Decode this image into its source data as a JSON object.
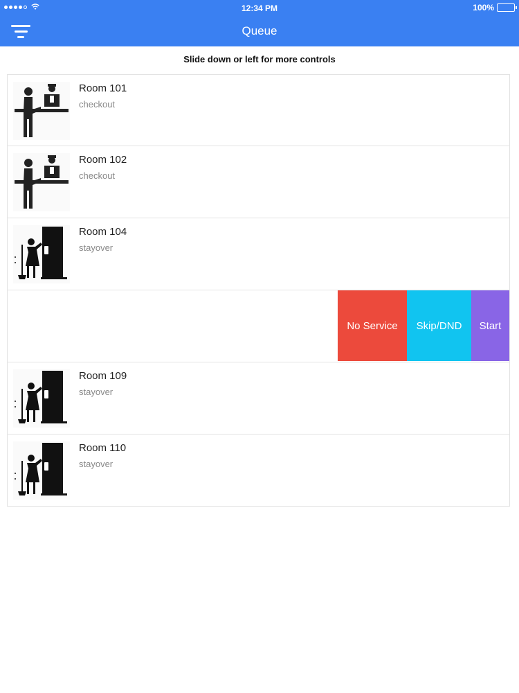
{
  "status_bar": {
    "time": "12:34 PM",
    "battery": "100%",
    "signal_bars": 4,
    "battery_level": 1.0
  },
  "nav": {
    "title": "Queue",
    "filter_icon": "filter-icon"
  },
  "hint": "Slide down or left for more controls",
  "queue": [
    {
      "room": "Room 101",
      "type": "checkout",
      "icon": "checkout-icon"
    },
    {
      "room": "Room 102",
      "type": "checkout",
      "icon": "checkout-icon"
    },
    {
      "room": "Room 104",
      "type": "stayover",
      "icon": "stayover-icon"
    },
    {
      "room": "",
      "type": "",
      "icon": ""
    },
    {
      "room": "Room 109",
      "type": "stayover",
      "icon": "stayover-icon"
    },
    {
      "room": "Room 110",
      "type": "stayover",
      "icon": "stayover-icon"
    }
  ],
  "swipe_actions": {
    "no_service": "No Service",
    "skip_dnd": "Skip/DND",
    "start": "Start"
  },
  "colors": {
    "header": "#3a80f2",
    "no_service": "#ec4a3c",
    "skip_dnd": "#11c4f0",
    "start": "#8965e6"
  }
}
